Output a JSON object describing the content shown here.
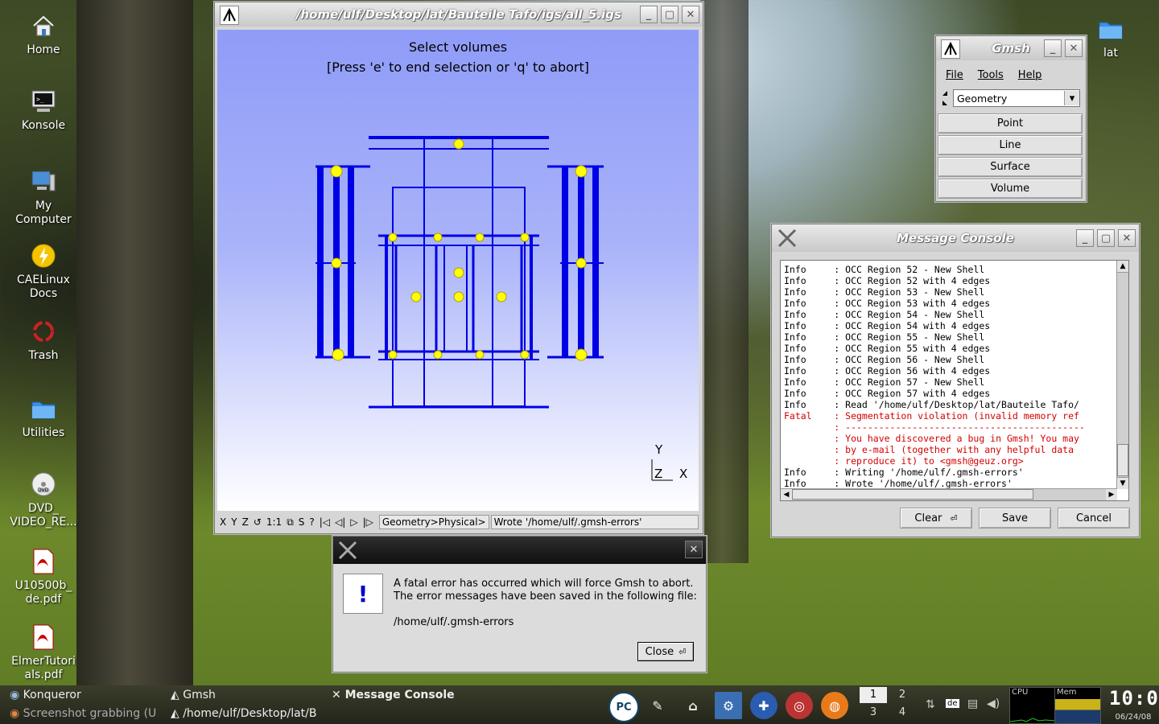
{
  "desktop": {
    "icons": [
      {
        "label": "Home",
        "icon": "home-icon"
      },
      {
        "label": "Konsole",
        "icon": "terminal-icon"
      },
      {
        "label": "My\nComputer",
        "icon": "computer-icon"
      },
      {
        "label": "CAELinux\nDocs",
        "icon": "docs-icon"
      },
      {
        "label": "Trash",
        "icon": "trash-icon"
      },
      {
        "label": "Utilities",
        "icon": "folder-icon"
      },
      {
        "label": "DVD_\nVIDEO_RE...",
        "icon": "dvd-icon"
      },
      {
        "label": "U10500b_\nde.pdf",
        "icon": "pdf-icon"
      },
      {
        "label": "ElmerTutori\nals.pdf",
        "icon": "pdf-icon"
      }
    ],
    "right_icon": {
      "label": "lat",
      "icon": "folder-icon"
    }
  },
  "graphics_window": {
    "title": "/home/ulf/Desktop/lat/Bauteile Tafo/igs/all_5.igs",
    "prompt_line1": "Select volumes",
    "prompt_line2": "[Press 'e' to end selection or 'q' to abort]",
    "axis_y": "Y",
    "axis_z": "Z",
    "axis_x": "X",
    "status_buttons": [
      "X",
      "Y",
      "Z",
      "↺",
      "1:1",
      "⧉",
      "S",
      "?",
      "|◁",
      "◁|",
      "▷",
      "|▷"
    ],
    "status_context": "Geometry>Physical>",
    "status_message": "Wrote '/home/ulf/.gmsh-errors'"
  },
  "gmsh_menu": {
    "title": "Gmsh",
    "menu": [
      "File",
      "Tools",
      "Help"
    ],
    "module": "Geometry",
    "buttons": [
      "Point",
      "Line",
      "Surface",
      "Volume"
    ]
  },
  "message_console": {
    "title": "Message Console",
    "lines": [
      {
        "level": "Info",
        "text": ": OCC Region 52 - New Shell",
        "color": "#000000"
      },
      {
        "level": "Info",
        "text": ": OCC Region 52 with 4 edges",
        "color": "#000000"
      },
      {
        "level": "Info",
        "text": ": OCC Region 53 - New Shell",
        "color": "#000000"
      },
      {
        "level": "Info",
        "text": ": OCC Region 53 with 4 edges",
        "color": "#000000"
      },
      {
        "level": "Info",
        "text": ": OCC Region 54 - New Shell",
        "color": "#000000"
      },
      {
        "level": "Info",
        "text": ": OCC Region 54 with 4 edges",
        "color": "#000000"
      },
      {
        "level": "Info",
        "text": ": OCC Region 55 - New Shell",
        "color": "#000000"
      },
      {
        "level": "Info",
        "text": ": OCC Region 55 with 4 edges",
        "color": "#000000"
      },
      {
        "level": "Info",
        "text": ": OCC Region 56 - New Shell",
        "color": "#000000"
      },
      {
        "level": "Info",
        "text": ": OCC Region 56 with 4 edges",
        "color": "#000000"
      },
      {
        "level": "Info",
        "text": ": OCC Region 57 - New Shell",
        "color": "#000000"
      },
      {
        "level": "Info",
        "text": ": OCC Region 57 with 4 edges",
        "color": "#000000"
      },
      {
        "level": "Info",
        "text": ": Read '/home/ulf/Desktop/lat/Bauteile Tafo/",
        "color": "#000000"
      },
      {
        "level": "Fatal",
        "text": ": Segmentation violation (invalid memory ref",
        "color": "#d40000"
      },
      {
        "level": "",
        "text": ": -------------------------------------------",
        "color": "#d40000"
      },
      {
        "level": "",
        "text": ": You have discovered a bug in Gmsh! You may",
        "color": "#d40000"
      },
      {
        "level": "",
        "text": ": by e-mail (together with any helpful data",
        "color": "#d40000"
      },
      {
        "level": "",
        "text": ": reproduce it) to <gmsh@geuz.org>",
        "color": "#d40000"
      },
      {
        "level": "Info",
        "text": ": Writing '/home/ulf/.gmsh-errors'",
        "color": "#000000"
      },
      {
        "level": "Info",
        "text": ": Wrote '/home/ulf/.gmsh-errors'",
        "color": "#000000"
      }
    ],
    "clear_label": "Clear",
    "save_label": "Save",
    "cancel_label": "Cancel"
  },
  "error_dialog": {
    "line1": "A fatal error has occurred which will force Gmsh to abort.",
    "line2": "The error messages have been saved in the following file:",
    "path": "/home/ulf/.gmsh-errors",
    "close_label": "Close",
    "icon": "!"
  },
  "taskbar": {
    "tasks": [
      "Konqueror",
      "Gmsh",
      "Message Console",
      "Screenshot grabbing (U",
      "/home/ulf/Desktop/lat/B"
    ],
    "launchers": [
      "PC"
    ],
    "pager": [
      "1",
      "2",
      "3",
      "4"
    ],
    "keyboard": "de",
    "cpu_label": "CPU",
    "mem_label": "Mem",
    "clock": "10:08",
    "date": "06/24/08"
  },
  "colors": {
    "viewport_top": "#8f9cf8",
    "viewport_bottom": "#ffffff",
    "geometry": "#0000e6",
    "points": "#ffff00",
    "fatal": "#d40000"
  }
}
